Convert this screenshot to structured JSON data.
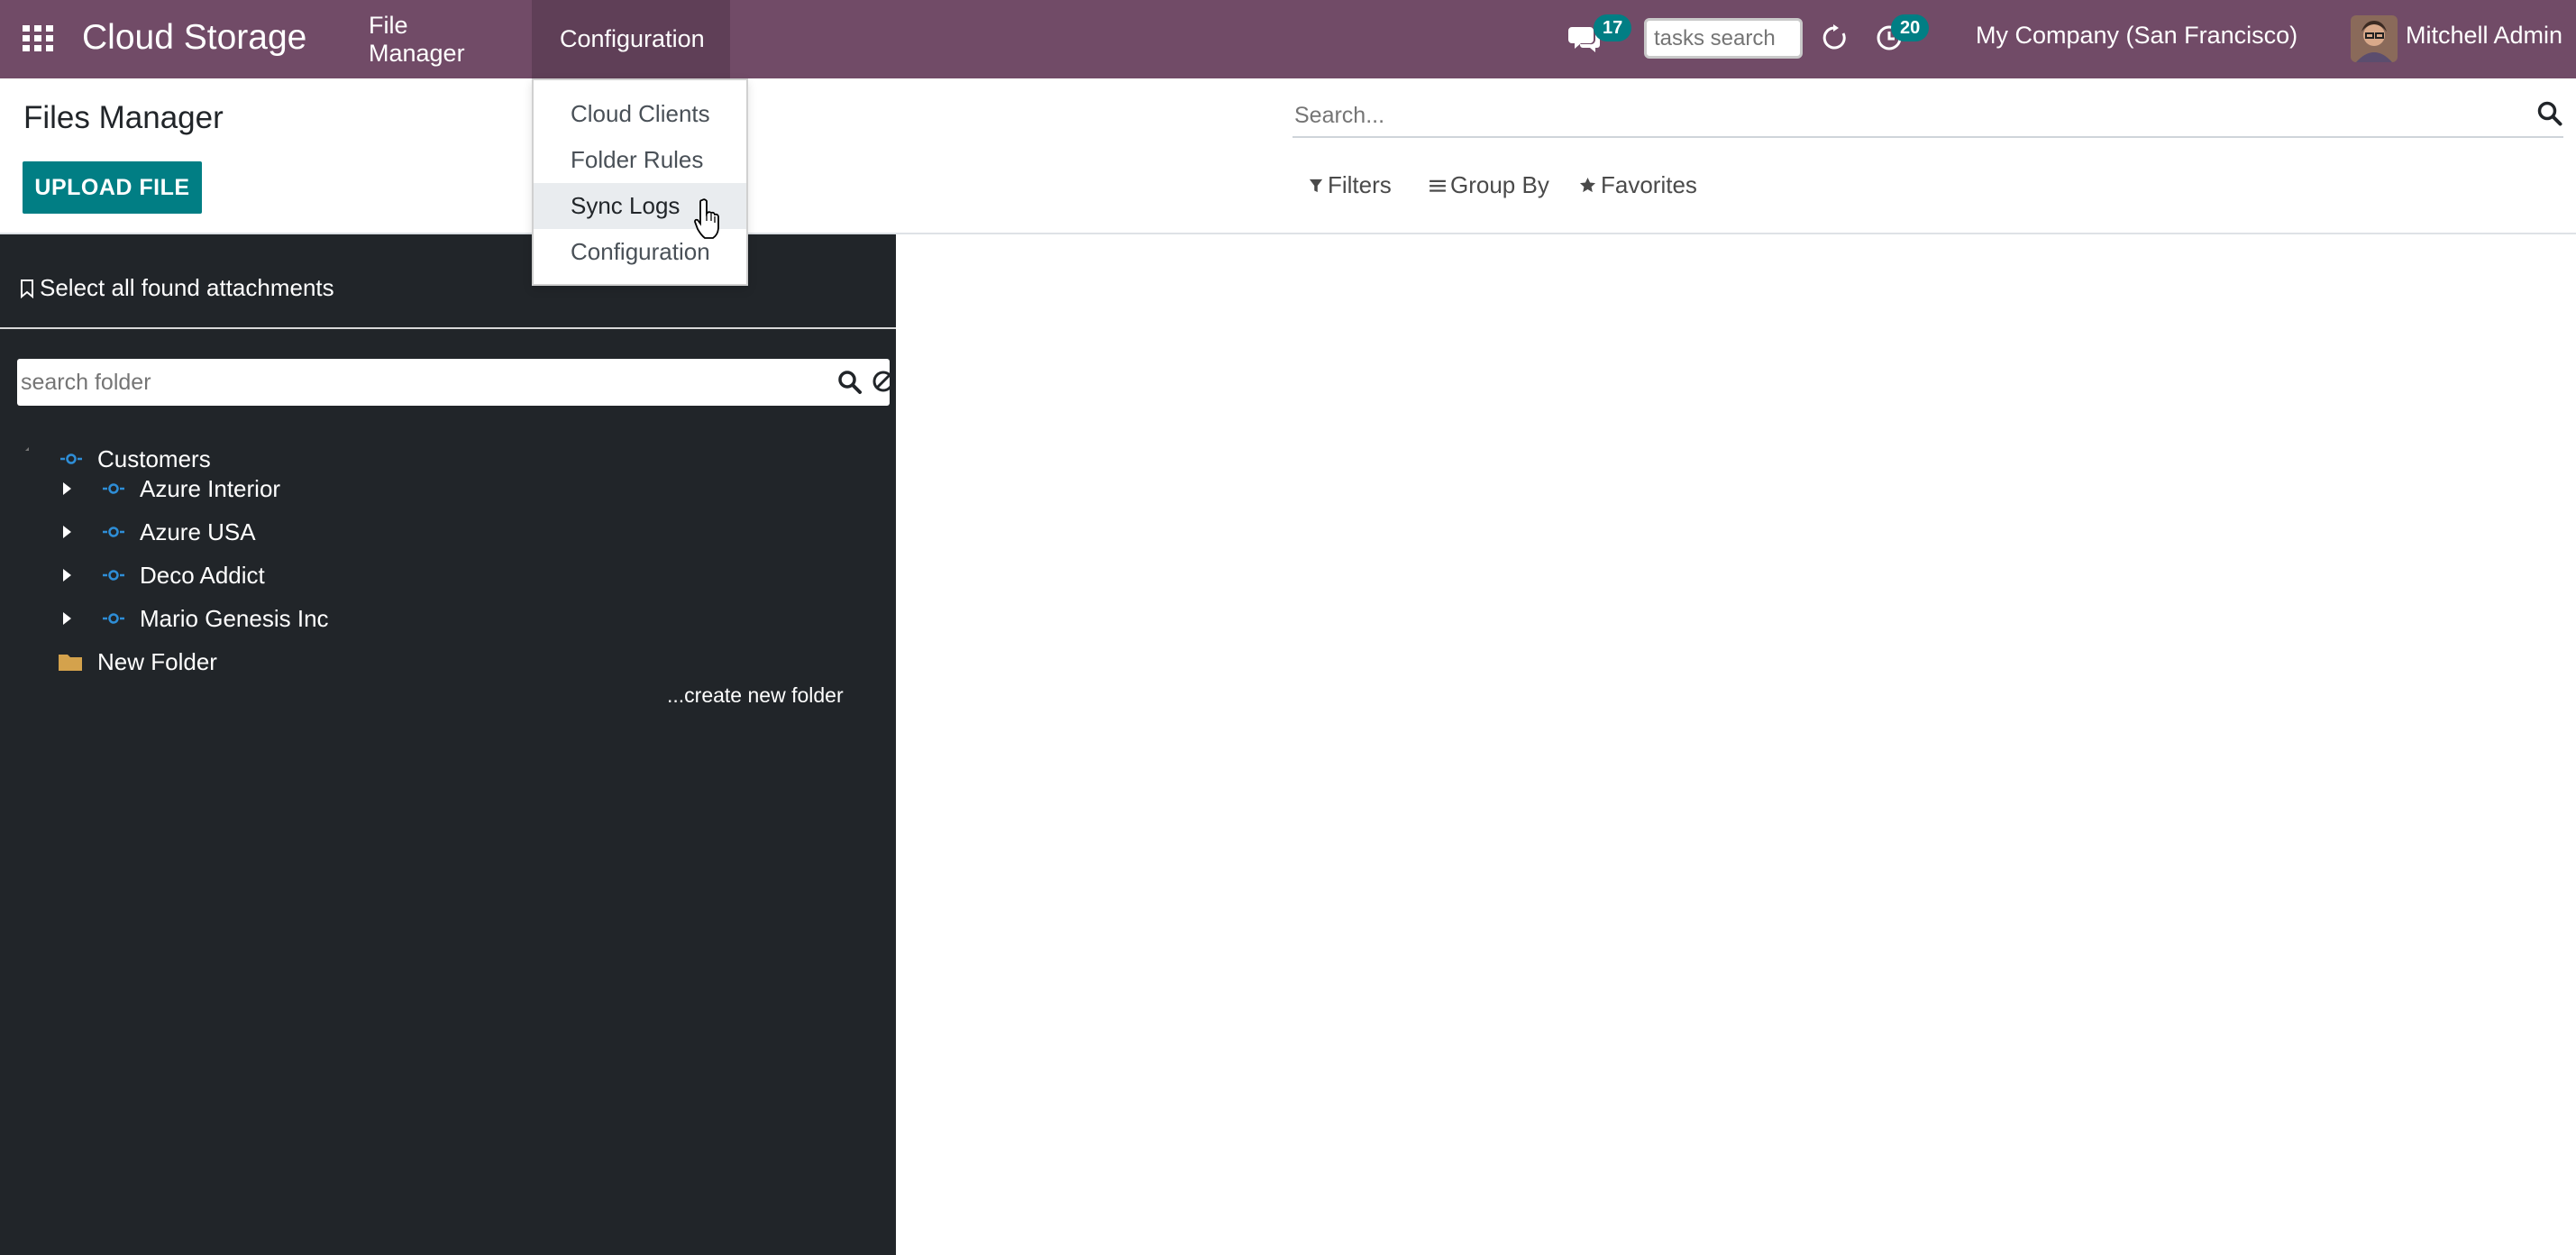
{
  "navbar": {
    "brand": "Cloud Storage",
    "menus": [
      {
        "label": "File Manager"
      },
      {
        "label": "Configuration"
      }
    ],
    "chat_badge": "17",
    "tasks_search_placeholder": "tasks search",
    "activity_badge": "20",
    "company": "My Company (San Francisco)",
    "user": "Mitchell Admin",
    "icons": [
      "apps-grid-icon",
      "chat-icon",
      "refresh-icon",
      "clock-icon"
    ]
  },
  "dropdown": {
    "items": [
      {
        "label": "Cloud Clients"
      },
      {
        "label": "Folder Rules"
      },
      {
        "label": "Sync Logs",
        "hovered": true
      },
      {
        "label": "Configuration"
      }
    ]
  },
  "control_panel": {
    "title": "Files Manager",
    "upload_label": "UPLOAD FILE",
    "search_placeholder": "Search...",
    "filters_label": "Filters",
    "groupby_label": "Group By",
    "favorites_label": "Favorites"
  },
  "sidebar": {
    "select_all_label": "Select all found attachments",
    "folder_search_placeholder": "search folder",
    "tree": [
      {
        "label": "Customers",
        "expanded": true
      },
      {
        "label": "Azure Interior"
      },
      {
        "label": "Azure USA"
      },
      {
        "label": "Deco Addict"
      },
      {
        "label": "Mario Genesis Inc"
      },
      {
        "label": "New Folder"
      }
    ],
    "create_folder_label": "...create new folder"
  },
  "colors": {
    "navbar": "#714b67",
    "accent": "#017e84",
    "sidebar": "#212529",
    "folder": "#d4a24c",
    "node": "#2e8ed7"
  }
}
